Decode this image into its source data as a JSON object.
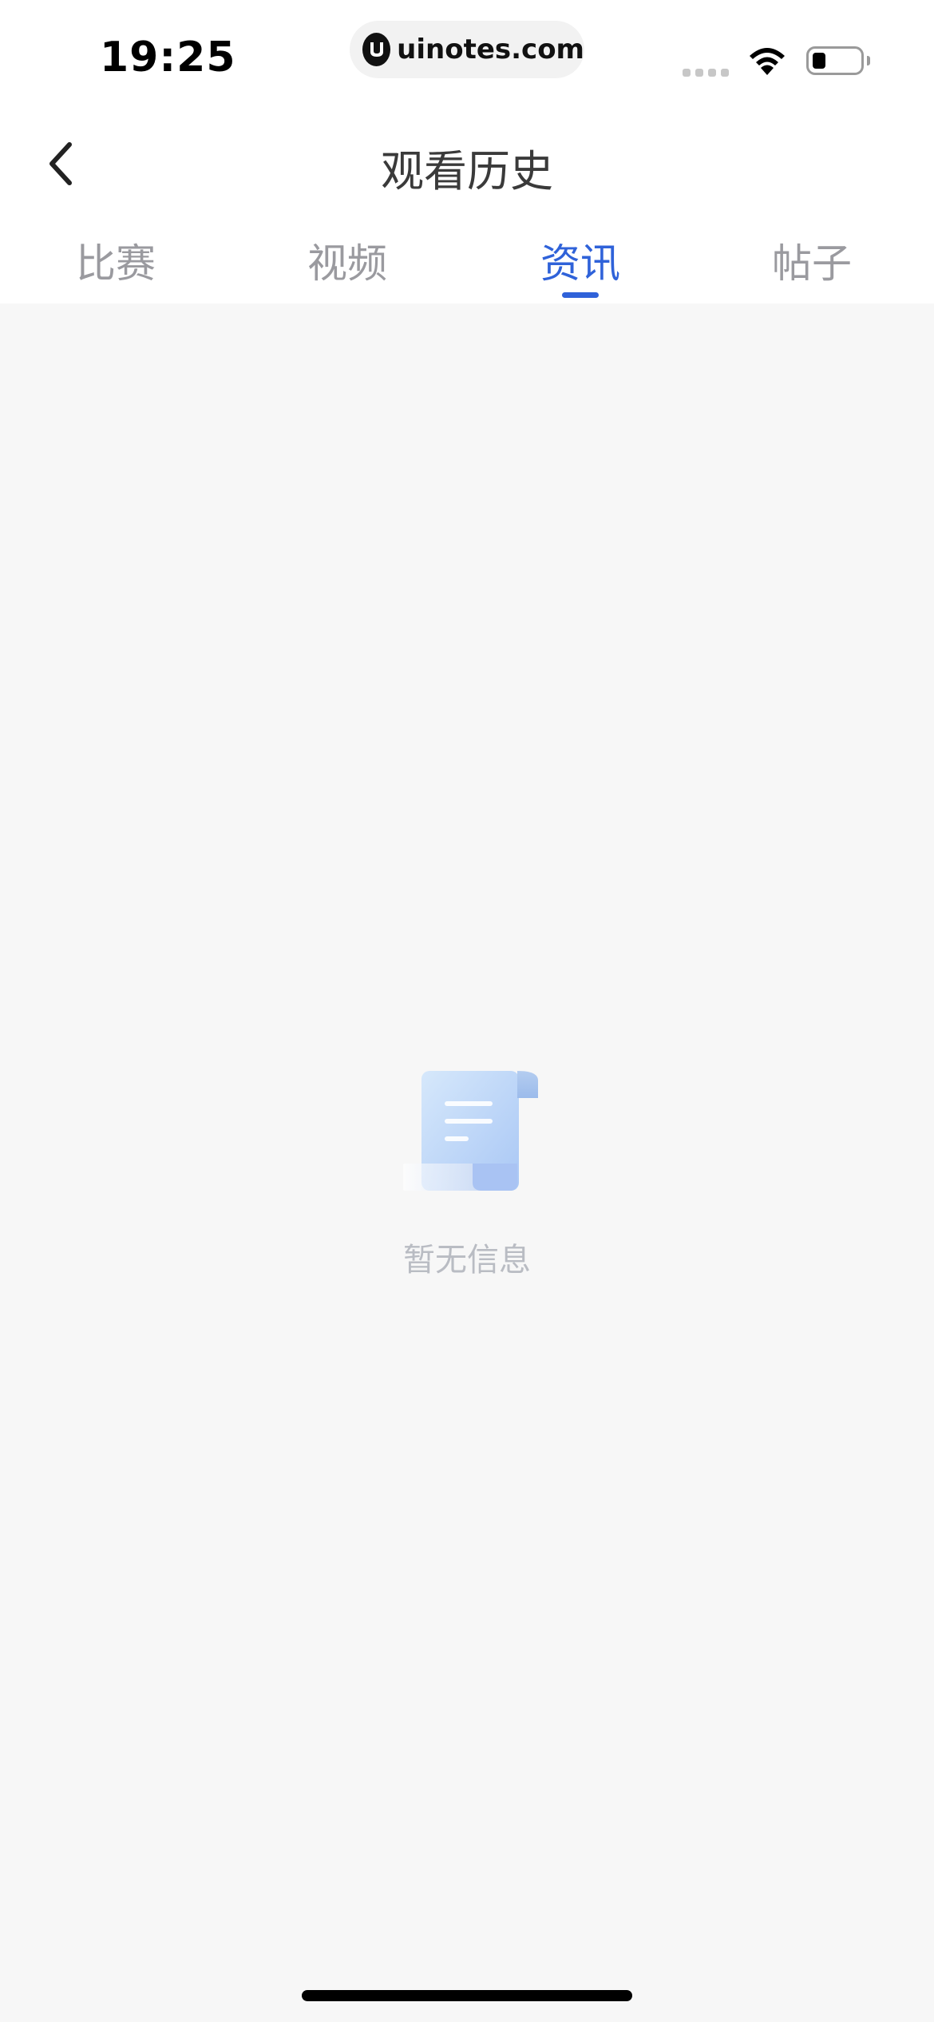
{
  "status_bar": {
    "time": "19:25",
    "url": "uinotes.com"
  },
  "header": {
    "title": "观看历史"
  },
  "tabs": [
    {
      "label": "比赛",
      "active": false
    },
    {
      "label": "视频",
      "active": false
    },
    {
      "label": "资讯",
      "active": true
    },
    {
      "label": "帖子",
      "active": false
    }
  ],
  "empty_state": {
    "message": "暂无信息",
    "icon": "document-scroll-icon"
  },
  "colors": {
    "accent": "#2f62d9",
    "tab_inactive": "#9a9a9f",
    "background": "#f7f7f7"
  }
}
